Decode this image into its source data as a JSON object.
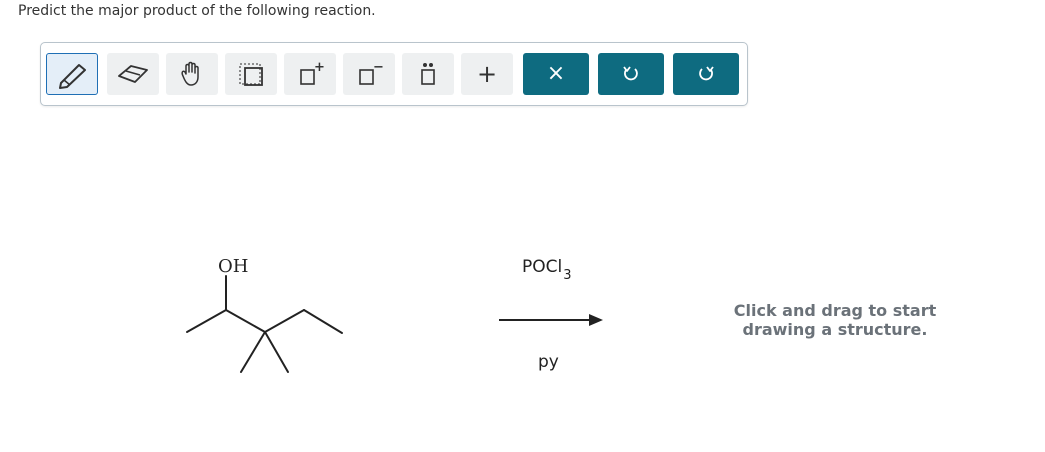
{
  "question": {
    "text": "Predict the major product of the following reaction."
  },
  "toolbar": {
    "tools": [
      {
        "name": "pencil-tool",
        "state": "active"
      },
      {
        "name": "eraser-tool"
      },
      {
        "name": "pan-hand-tool"
      },
      {
        "name": "select-box-tool"
      },
      {
        "name": "positive-charge-tool",
        "superscript": "+"
      },
      {
        "name": "negative-charge-tool",
        "superscript": "−"
      },
      {
        "name": "lone-pair-tool"
      },
      {
        "name": "zoom-add-tool",
        "glyph": "+"
      },
      {
        "name": "clear-button",
        "glyph": "×"
      },
      {
        "name": "undo-button"
      },
      {
        "name": "redo-button"
      }
    ],
    "colors": {
      "accent": "#0e6b80",
      "active_border": "#1f6fb5",
      "tool_bg": "#eef0f1"
    }
  },
  "reaction": {
    "reactant_label": "OH",
    "reagent_above": "POCl",
    "reagent_above_subscript": "3",
    "reagent_below": "py"
  },
  "canvas_hint": {
    "line1": "Click and drag to start",
    "line2": "drawing a structure."
  }
}
